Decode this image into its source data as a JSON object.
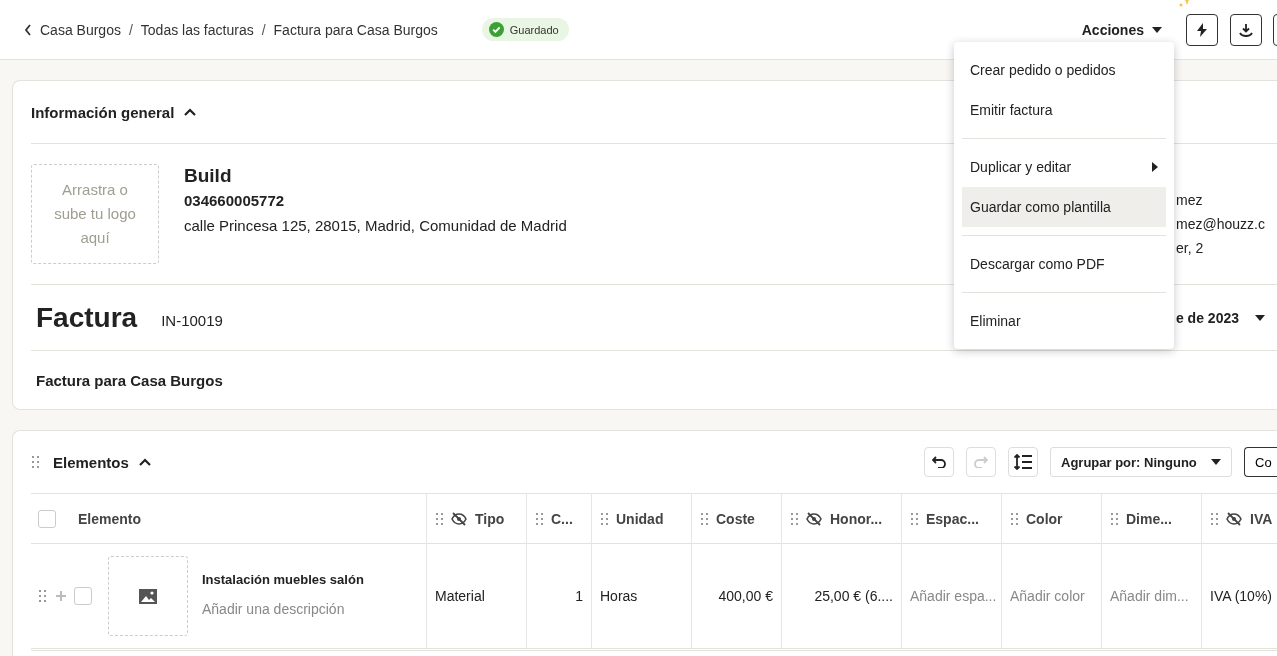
{
  "breadcrumbs": [
    {
      "label": "Casa Burgos"
    },
    {
      "separator": "/",
      "label": "Todas las facturas"
    },
    {
      "separator": "/",
      "label": "Factura para Casa Burgos"
    }
  ],
  "status_badge": "Guardado",
  "actions_button": "Acciones",
  "actions_menu": [
    {
      "label": "Crear pedido o pedidos",
      "submenu": false,
      "selected": false,
      "divider_after": false
    },
    {
      "label": "Emitir factura",
      "submenu": false,
      "selected": false,
      "divider_after": true
    },
    {
      "label": "Duplicar y editar",
      "submenu": true,
      "selected": false,
      "divider_after": false
    },
    {
      "label": "Guardar como plantilla",
      "submenu": false,
      "selected": true,
      "divider_after": true
    },
    {
      "label": "Descargar como PDF",
      "submenu": false,
      "selected": false,
      "divider_after": true
    },
    {
      "label": "Eliminar",
      "submenu": false,
      "selected": false,
      "divider_after": false
    }
  ],
  "general_info": {
    "title": "Información general",
    "expanded": true,
    "logo_dropzone": "Arrastra o sube tu logo aquí",
    "company": {
      "name": "Build",
      "tax_id": "034660005772",
      "address": "calle Princesa 125, 28015, Madrid, Comunidad de Madrid"
    },
    "client_partial": [
      "mez",
      "mez@houzz.c",
      "er, 2"
    ],
    "document_type": "Factura",
    "number": "IN-10019",
    "date_partial": "e de 2023",
    "title_text": "Factura para Casa Burgos"
  },
  "items": {
    "title": "Elementos",
    "expanded": true,
    "toolbar": {
      "redo_disabled": true,
      "group_by": "Agrupar por: Ninguno",
      "cut_button": "Co"
    },
    "columns": [
      {
        "label": "Elemento",
        "hidden": false
      },
      {
        "label": "Tipo",
        "hidden": true
      },
      {
        "label": "C...",
        "hidden": false
      },
      {
        "label": "Unidad",
        "hidden": false
      },
      {
        "label": "Coste",
        "hidden": false
      },
      {
        "label": "Honor...",
        "hidden": true
      },
      {
        "label": "Espac...",
        "hidden": false
      },
      {
        "label": "Color",
        "hidden": false
      },
      {
        "label": "Dime...",
        "hidden": false
      },
      {
        "label": "IVA",
        "hidden": true
      }
    ],
    "select_all_checked": false,
    "rows": [
      {
        "cells": [
          {
            "kind": "item",
            "checked": false,
            "name": "Instalación muebles salón",
            "description_placeholder": "Añadir una descripción"
          },
          {
            "kind": "text",
            "text": "Material"
          },
          {
            "kind": "number",
            "text": "1"
          },
          {
            "kind": "text",
            "text": "Horas"
          },
          {
            "kind": "number",
            "text": "400,00 €"
          },
          {
            "kind": "number",
            "text": "25,00 € (6...."
          },
          {
            "kind": "placeholder",
            "text": "Añadir espa..."
          },
          {
            "kind": "placeholder",
            "text": "Añadir color"
          },
          {
            "kind": "placeholder",
            "text": "Añadir dim..."
          },
          {
            "kind": "text",
            "text": "IVA (10%)"
          }
        ]
      }
    ]
  }
}
